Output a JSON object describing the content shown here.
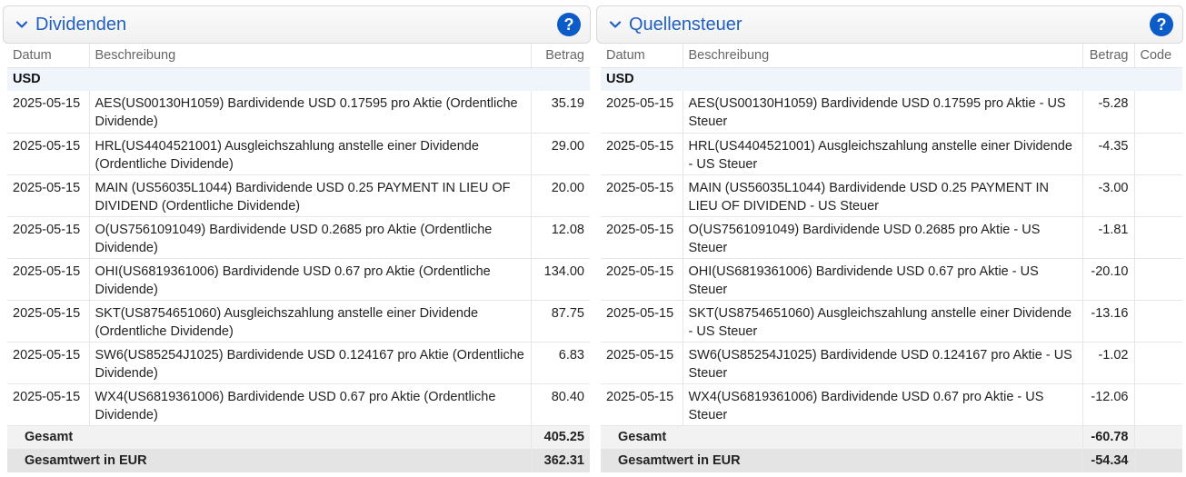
{
  "dividends": {
    "title": "Dividenden",
    "help_label": "?",
    "headers": {
      "date": "Datum",
      "desc": "Beschreibung",
      "amount": "Betrag"
    },
    "currency": "USD",
    "rows": [
      {
        "date": "2025-05-15",
        "desc": "AES(US00130H1059) Bardividende USD 0.17595 pro Aktie (Ordentliche Dividende)",
        "amount": "35.19"
      },
      {
        "date": "2025-05-15",
        "desc": "HRL(US4404521001) Ausgleichszahlung anstelle einer Dividende (Ordentliche Dividende)",
        "amount": "29.00"
      },
      {
        "date": "2025-05-15",
        "desc": "MAIN (US56035L1044) Bardividende USD 0.25 PAYMENT IN LIEU OF DIVIDEND (Ordentliche Dividende)",
        "amount": "20.00"
      },
      {
        "date": "2025-05-15",
        "desc": "O(US7561091049) Bardividende USD 0.2685 pro Aktie (Ordentliche Dividende)",
        "amount": "12.08"
      },
      {
        "date": "2025-05-15",
        "desc": "OHI(US6819361006) Bardividende USD 0.67 pro Aktie (Ordentliche Dividende)",
        "amount": "134.00"
      },
      {
        "date": "2025-05-15",
        "desc": "SKT(US8754651060) Ausgleichszahlung anstelle einer Dividende (Ordentliche Dividende)",
        "amount": "87.75"
      },
      {
        "date": "2025-05-15",
        "desc": "SW6(US85254J1025) Bardividende USD 0.124167 pro Aktie (Ordentliche Dividende)",
        "amount": "6.83"
      },
      {
        "date": "2025-05-15",
        "desc": "WX4(US6819361006) Bardividende USD 0.67 pro Aktie (Ordentliche Dividende)",
        "amount": "80.40"
      }
    ],
    "total_label": "Gesamt",
    "total": "405.25",
    "total_eur_label": "Gesamtwert in EUR",
    "total_eur": "362.31"
  },
  "withholding": {
    "title": "Quellensteuer",
    "help_label": "?",
    "headers": {
      "date": "Datum",
      "desc": "Beschreibung",
      "amount": "Betrag",
      "code": "Code"
    },
    "currency": "USD",
    "rows": [
      {
        "date": "2025-05-15",
        "desc": "AES(US00130H1059) Bardividende USD 0.17595 pro Aktie - US Steuer",
        "amount": "-5.28",
        "code": ""
      },
      {
        "date": "2025-05-15",
        "desc": "HRL(US4404521001) Ausgleichszahlung anstelle einer Dividende - US Steuer",
        "amount": "-4.35",
        "code": ""
      },
      {
        "date": "2025-05-15",
        "desc": "MAIN (US56035L1044) Bardividende USD 0.25 PAYMENT IN LIEU OF DIVIDEND - US Steuer",
        "amount": "-3.00",
        "code": ""
      },
      {
        "date": "2025-05-15",
        "desc": "O(US7561091049) Bardividende USD 0.2685 pro Aktie - US Steuer",
        "amount": "-1.81",
        "code": ""
      },
      {
        "date": "2025-05-15",
        "desc": "OHI(US6819361006) Bardividende USD 0.67 pro Aktie - US Steuer",
        "amount": "-20.10",
        "code": ""
      },
      {
        "date": "2025-05-15",
        "desc": "SKT(US8754651060) Ausgleichszahlung anstelle einer Dividende - US Steuer",
        "amount": "-13.16",
        "code": ""
      },
      {
        "date": "2025-05-15",
        "desc": "SW6(US85254J1025) Bardividende USD 0.124167 pro Aktie - US Steuer",
        "amount": "-1.02",
        "code": ""
      },
      {
        "date": "2025-05-15",
        "desc": "WX4(US6819361006) Bardividende USD 0.67 pro Aktie - US Steuer",
        "amount": "-12.06",
        "code": ""
      }
    ],
    "total_label": "Gesamt",
    "total": "-60.78",
    "total_eur_label": "Gesamtwert in EUR",
    "total_eur": "-54.34"
  },
  "colors": {
    "accent": "#1f5fbf",
    "help_bg": "#0b5cc7",
    "group_bg": "#f0f4fb"
  },
  "icons": {
    "collapse": "chevron-down-icon",
    "help": "help-icon"
  }
}
